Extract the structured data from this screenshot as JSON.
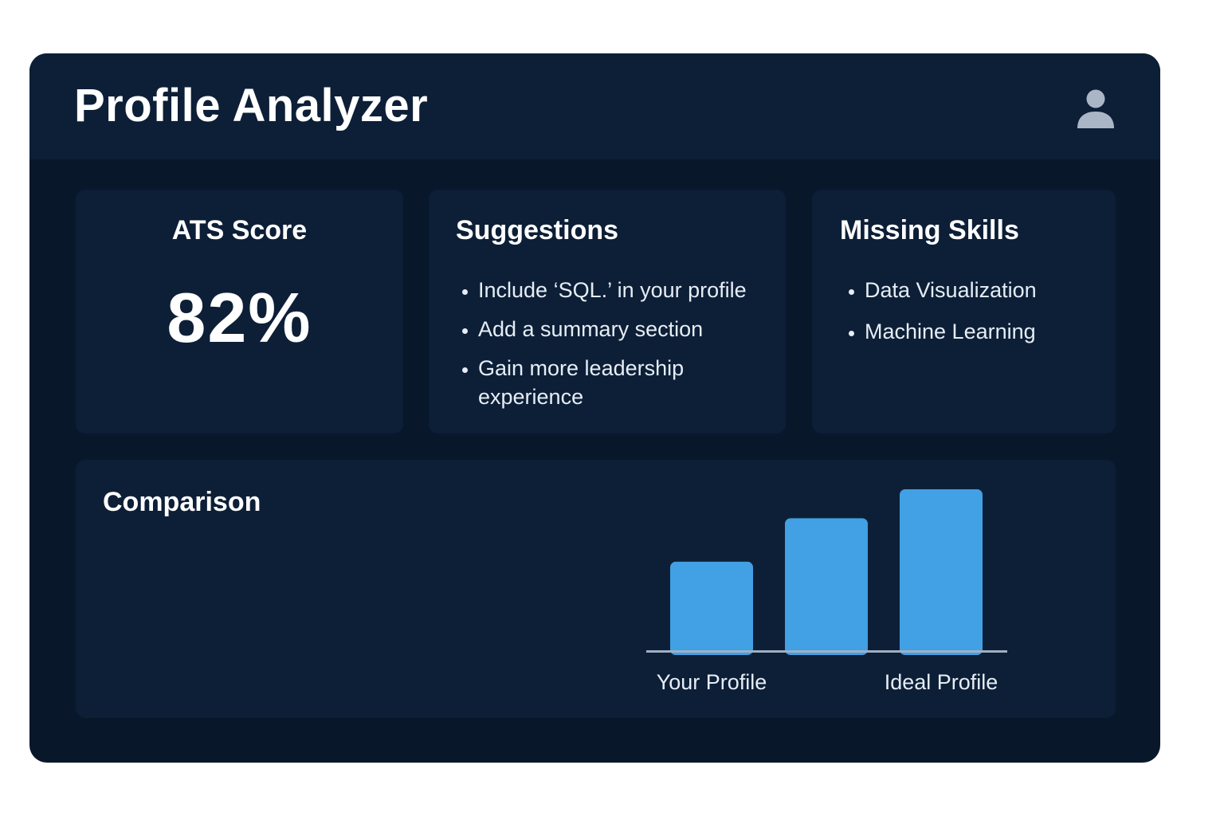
{
  "app": {
    "title": "Profile Analyzer",
    "avatar_icon": "user-icon"
  },
  "ats": {
    "title": "ATS Score",
    "value": "82%"
  },
  "suggestions": {
    "title": "Suggestions",
    "items": [
      "Include ‘SQL.’ in your profile",
      "Add a summary section",
      "Gain more leadership experience"
    ]
  },
  "missing_skills": {
    "title": "Missing Skills",
    "items": [
      "Data Visualization",
      "Machine Learning"
    ]
  },
  "comparison": {
    "title": "Comparison"
  },
  "chart_data": {
    "type": "bar",
    "categories": [
      "Your Profile",
      "",
      "Ideal Profile"
    ],
    "values": [
      55,
      82,
      100
    ],
    "bar_color": "#42a0e4",
    "axis_color": "#9fb0c4",
    "grid": false
  },
  "colors": {
    "window_bg": "#08172a",
    "panel_bg": "#0d1f37",
    "accent": "#42a0e4",
    "text": "#ffffff"
  }
}
